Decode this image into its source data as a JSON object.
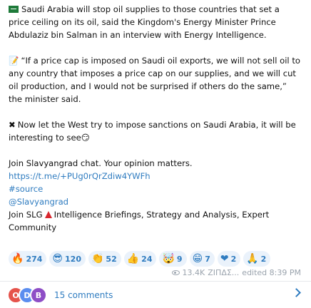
{
  "post": {
    "p1": "Saudi Arabia will stop oil supplies to those countries that set a price ceiling on its oil, said the Kingdom's Energy Minister Prince Abdulaziz bin Salman in an interview with Energy Intelligence.",
    "p2": "“If a price cap is imposed on Saudi oil exports, we will not sell oil to any country that imposes a price cap on our supplies, and we will cut oil production, and I would not be surprised if others do the same,” the minister said.",
    "p3_emoji": "✖",
    "p3": "Now let the West try to impose sanctions on Saudi Arabia, it will be interesting to see",
    "p3_tail_emoji": "😏",
    "p2_emoji": "📝",
    "join_chat": "Join Slavyangrad chat. Your opinion matters.",
    "chat_link": "https://t.me/+PUg0rQrZdiw4YWFh",
    "source_tag": "#source",
    "handle": "@Slavyangrad",
    "join_slg_prefix": "Join SLG",
    "join_slg_suffix": "Intelligence Briefings, Strategy and Analysis, Expert Community"
  },
  "reactions": [
    {
      "emoji": "🔥",
      "count": "274"
    },
    {
      "emoji": "😎",
      "count": "120"
    },
    {
      "emoji": "👏",
      "count": "52"
    },
    {
      "emoji": "👍",
      "count": "24"
    },
    {
      "emoji": "🤯",
      "count": "9"
    },
    {
      "emoji": "😁",
      "count": "7"
    },
    {
      "emoji": "❤",
      "count": "2"
    },
    {
      "emoji": "🙏",
      "count": "2"
    }
  ],
  "meta": {
    "views": "13.4K",
    "author": "ΖΙΠΔΣ...",
    "edited": "edited 8:39 PM"
  },
  "comments": {
    "label": "15 comments",
    "avatars": [
      {
        "initial": "O",
        "color": "#e5534b"
      },
      {
        "initial": "D",
        "color": "#5b8def"
      },
      {
        "initial": "B",
        "color": "#8e4ec6"
      }
    ]
  }
}
